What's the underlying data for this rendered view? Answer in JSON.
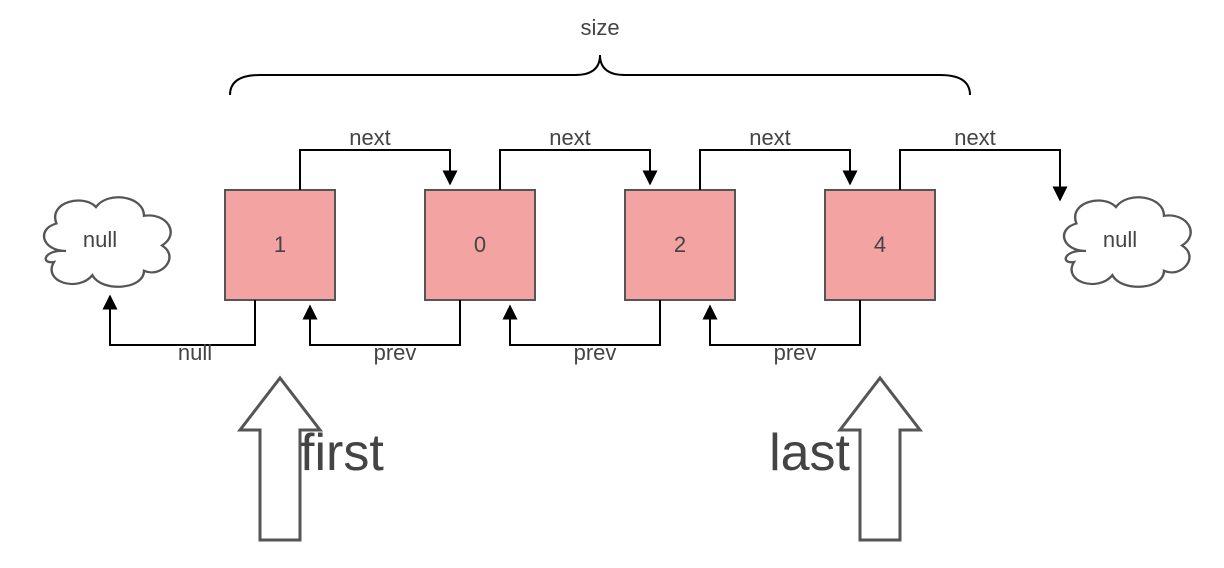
{
  "title": "size",
  "nodes": [
    "1",
    "0",
    "2",
    "4"
  ],
  "leftCloud": "null",
  "rightCloud": "null",
  "nextLabel": "next",
  "prevLabel": "prev",
  "nullArrowLabel": "null",
  "firstLabel": "first",
  "lastLabel": "last",
  "colors": {
    "node": "#f4a3a3",
    "stroke": "#555"
  }
}
